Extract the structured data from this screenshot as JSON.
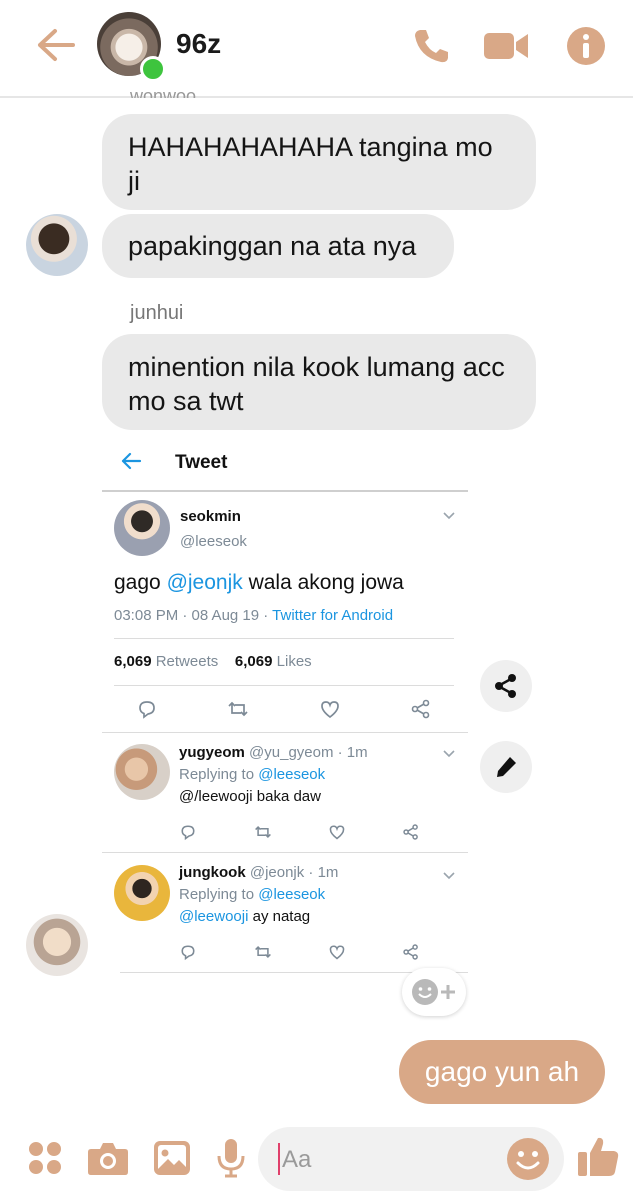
{
  "header": {
    "title": "96z",
    "online": true,
    "icons": [
      "back-arrow-icon",
      "phone-icon",
      "video-camera-icon",
      "info-icon"
    ]
  },
  "colors": {
    "accent": "#d9a887",
    "bubble_in": "#e9e9e9",
    "online": "#3ec43e",
    "twitter_blue": "#1b95e0"
  },
  "messages": {
    "cutoff_name": "wonwoo",
    "m1": "HAHAHAHAHAHA tangina mo ji",
    "m2": "papakinggan na ata nya",
    "sender2": "junhui",
    "m3": "minention nila kook lumang acc mo sa twt",
    "my_reply": "gago yun ah"
  },
  "tweet": {
    "header_title": "Tweet",
    "author_name": "seokmin",
    "author_handle": "@leeseok",
    "text_prefix": "gago ",
    "text_mention": "@jeonjk",
    "text_suffix": " wala akong jowa",
    "time": "03:08 PM · 08 Aug 19 · ",
    "source": "Twitter for Android",
    "retweets_count": "6,069",
    "retweets_label": "Retweets",
    "likes_count": "6,069",
    "likes_label": "Likes",
    "replies": [
      {
        "name": "yugyeom",
        "handle": "@yu_gyeom · 1m",
        "replying_prefix": "Replying to ",
        "replying_to": "@leeseok",
        "text_mention": "",
        "text": "@/leewooji baka daw"
      },
      {
        "name": "jungkook",
        "handle": "@jeonjk · 1m",
        "replying_prefix": "Replying to ",
        "replying_to": "@leeseok",
        "text_mention": "@leewooji",
        "text": " ay natag"
      }
    ]
  },
  "composer": {
    "placeholder": "Aa",
    "icons": [
      "grid-dots-icon",
      "camera-icon",
      "gallery-icon",
      "microphone-icon",
      "emoji-icon",
      "thumbs-up-icon"
    ]
  }
}
